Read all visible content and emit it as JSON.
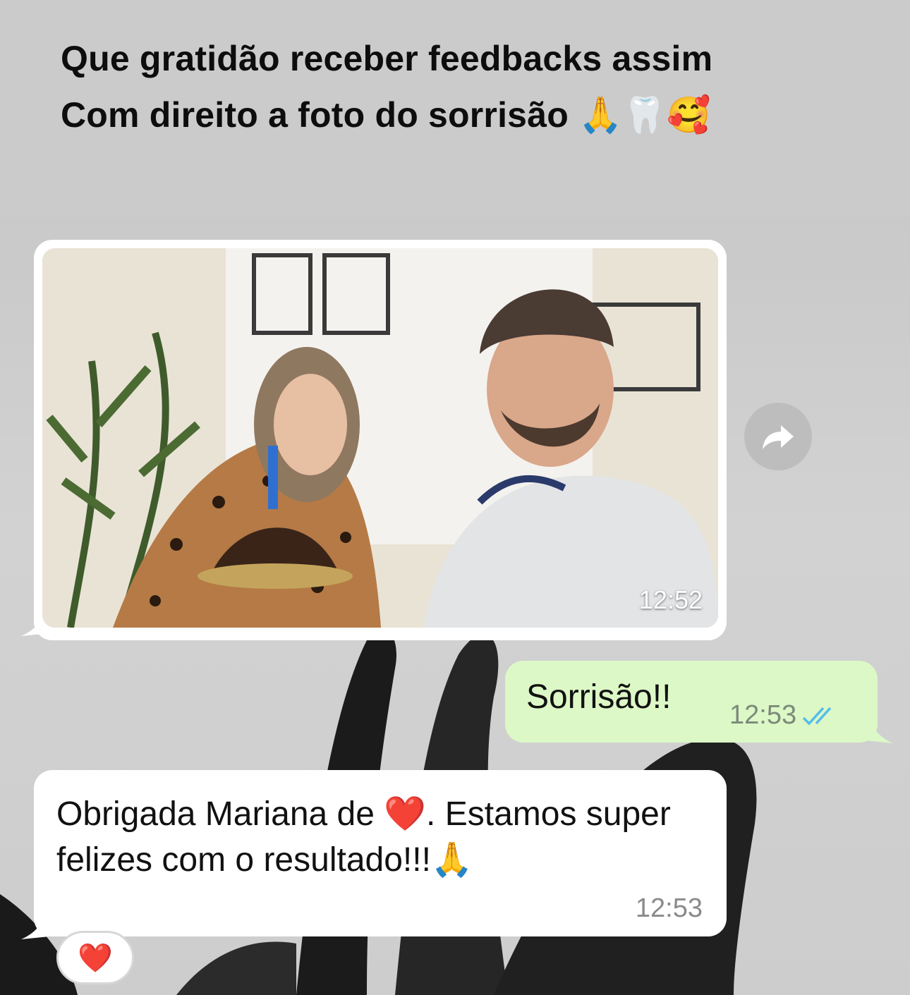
{
  "caption": {
    "line1": "Que gratidão receber feedbacks assim",
    "line2": "Com direito a foto do sorrisão",
    "line2_emojis": "🙏🦷🥰"
  },
  "messages": {
    "image_message": {
      "time": "12:52"
    },
    "outgoing": {
      "text": "Sorrisão!!",
      "time": "12:53",
      "status_icon": "double-check-icon"
    },
    "incoming": {
      "text_before_heart": "Obrigada Mariana de ",
      "heart": "❤️",
      "text_after_heart": ". Estamos super felizes com o resultado!!!",
      "end_emoji": "🙏",
      "time": "12:53"
    },
    "reaction": {
      "emoji": "❤️"
    }
  },
  "colors": {
    "incoming_bubble": "#ffffff",
    "outgoing_bubble": "#dcf8c6",
    "read_ticks": "#53bdeb",
    "caption_band": "#cbcbcb"
  }
}
